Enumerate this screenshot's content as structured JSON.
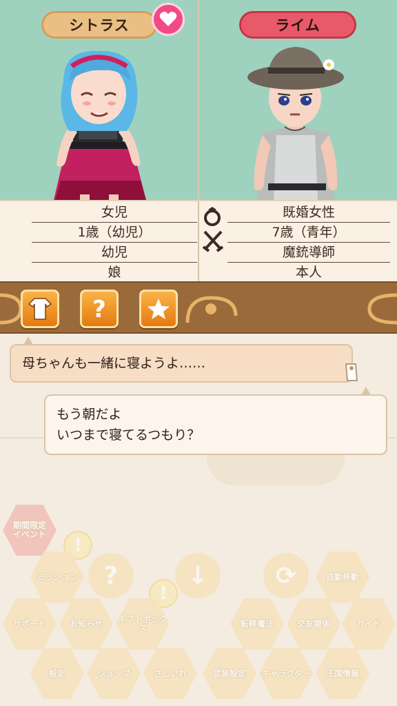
{
  "characters": {
    "left": {
      "name": "シトラス"
    },
    "right": {
      "name": "ライム"
    }
  },
  "info": {
    "left": [
      "女児",
      "1歳（幼児）",
      "幼児",
      "娘"
    ],
    "right": [
      "既婚女性",
      "7歳（青年）",
      "魔銃導師",
      "本人"
    ]
  },
  "toolbar": {
    "buttons": [
      "clothes-icon",
      "question-icon",
      "star-icon"
    ]
  },
  "chat": {
    "messages": [
      {
        "text": "母ちゃんも一緒に寝ようよ……"
      },
      {
        "line1": "もう朝だよ",
        "line2": "いつまで寝てるつもり？"
      }
    ]
  },
  "menu": {
    "event": "期間限定\nイベント",
    "mission": "ミッション",
    "support": "サポート",
    "news": "お知らせ",
    "gift": "ギフトボックス",
    "settings": "設定",
    "shop": "ショップ",
    "nikki": "さしいれ",
    "auto_move": "自動移動",
    "transfer": "転移魔法",
    "friends": "交友関係",
    "guide": "ガイド",
    "equip": "武装設定",
    "character": "キャラクター",
    "kingdom": "王国情報"
  },
  "colors": {
    "portrait_bg": "#9fd2be",
    "left_tag": "#e9bf86",
    "right_tag": "#e85a6a",
    "heart": "#f24a86",
    "toolbar": "#9b6a3a",
    "tool_button": "#f08f20"
  }
}
